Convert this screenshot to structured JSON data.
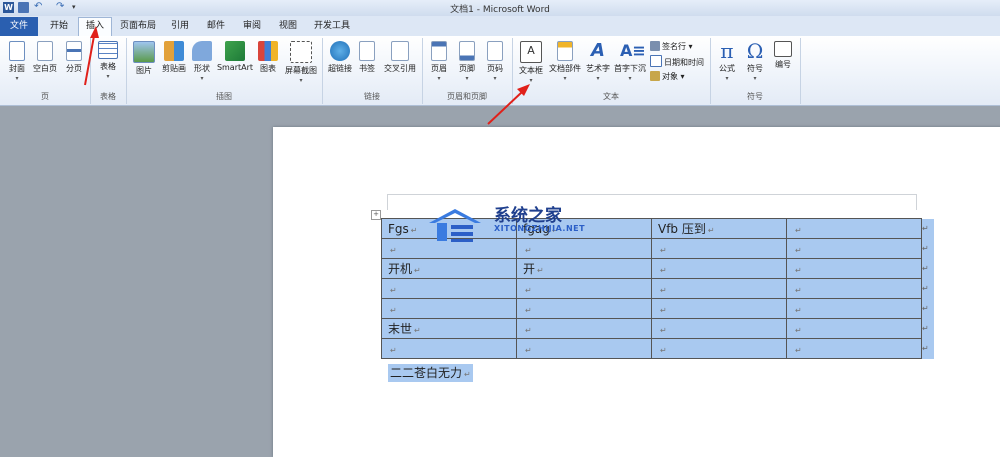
{
  "window": {
    "title": "文档1 - Microsoft Word"
  },
  "tabs": [
    "文件",
    "开始",
    "插入",
    "页面布局",
    "引用",
    "邮件",
    "审阅",
    "视图",
    "开发工具"
  ],
  "active_tab": "插入",
  "ribbon": {
    "groups": {
      "pages": "页",
      "tables": "表格",
      "illustrations": "插图",
      "links": "链接",
      "header_footer": "页眉和页脚",
      "text": "文本",
      "symbols": "符号"
    },
    "buttons": {
      "cover": "封面",
      "blank_page": "空白页",
      "page_break": "分页",
      "table": "表格",
      "picture": "图片",
      "clipart": "剪贴画",
      "shapes": "形状",
      "smartart": "SmartArt",
      "chart": "图表",
      "screenshot": "屏幕截图",
      "hyperlink": "超链接",
      "bookmark": "书签",
      "cross_ref": "交叉引用",
      "header": "页眉",
      "footer": "页脚",
      "page_number": "页码",
      "textbox": "文本框",
      "quickparts": "文档部件",
      "wordart": "艺术字",
      "dropcap": "首字下沉",
      "signature": "签名行",
      "datetime": "日期和时间",
      "object": "对象",
      "equation": "公式",
      "symbol": "符号",
      "numbering": "编号"
    }
  },
  "document": {
    "table": [
      [
        "Fgs",
        "fgag",
        "Vfb 压到",
        ""
      ],
      [
        "",
        "",
        "",
        ""
      ],
      [
        "开机",
        "开",
        "",
        ""
      ],
      [
        "",
        "",
        "",
        ""
      ],
      [
        "",
        "",
        "",
        ""
      ],
      [
        "末世",
        "",
        "",
        ""
      ],
      [
        "",
        "",
        "",
        ""
      ]
    ],
    "paragraph_mark": "↵",
    "below_text": "二二苍白无力"
  },
  "watermark": {
    "name": "系统之家",
    "url": "XITONGZHIJIA.NET"
  },
  "colors": {
    "accent": "#2a5fb0",
    "selection": "#a9c9f0",
    "arrow": "#e0201a"
  }
}
